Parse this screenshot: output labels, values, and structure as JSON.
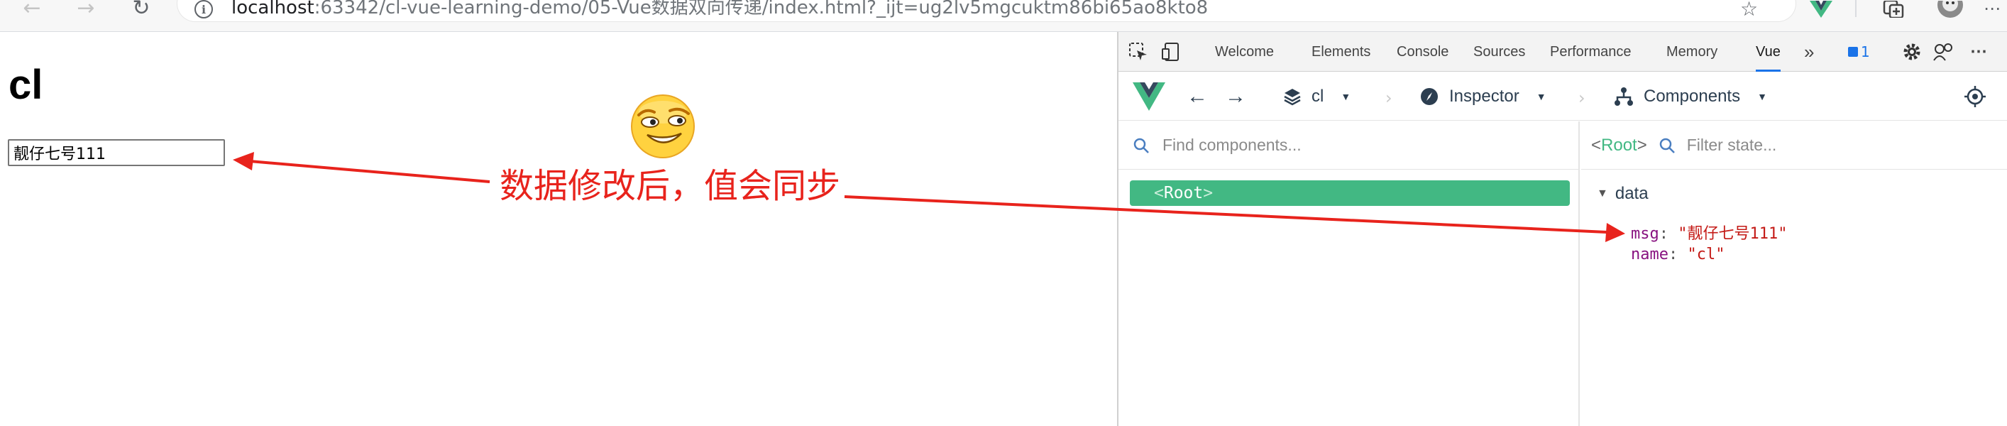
{
  "browser": {
    "url_host": "localhost",
    "url_rest": ":63342/cl-vue-learning-demo/05-Vue数据双向传递/index.html?_ijt=ug2lv5mgcuktm86bi65ao8kto8",
    "back_icon": "←",
    "forward_icon": "→",
    "reload_icon": "↻",
    "info_icon": "i",
    "star_icon": "☆"
  },
  "page": {
    "title": "cl",
    "input_value": "靓仔七号111"
  },
  "annotation": {
    "text": "数据修改后，值会同步",
    "color": "#e8231c"
  },
  "devtools": {
    "tabs": [
      "Welcome",
      "Elements",
      "Console",
      "Sources",
      "Performance",
      "Memory",
      "Vue"
    ],
    "active_tab": "Vue",
    "more_tabs_icon": "»",
    "issues_count": "1",
    "vue_toolbar": {
      "app_selector": "cl",
      "inspector_label": "Inspector",
      "components_label": "Components"
    },
    "component_tree": {
      "search_placeholder": "Find components...",
      "root_open": "<",
      "root_name": "Root",
      "root_close": ">"
    },
    "state_panel": {
      "selected_open": "<",
      "selected_name": "Root",
      "selected_close": ">",
      "filter_placeholder": "Filter state...",
      "section": "data",
      "rows": [
        {
          "key": "msg",
          "value": "\"靓仔七号111\""
        },
        {
          "key": "name",
          "value": "\"cl\""
        }
      ]
    }
  },
  "colors": {
    "vue_green": "#42b883",
    "vue_dark": "#35495e",
    "accent_blue": "#1a73e8"
  }
}
